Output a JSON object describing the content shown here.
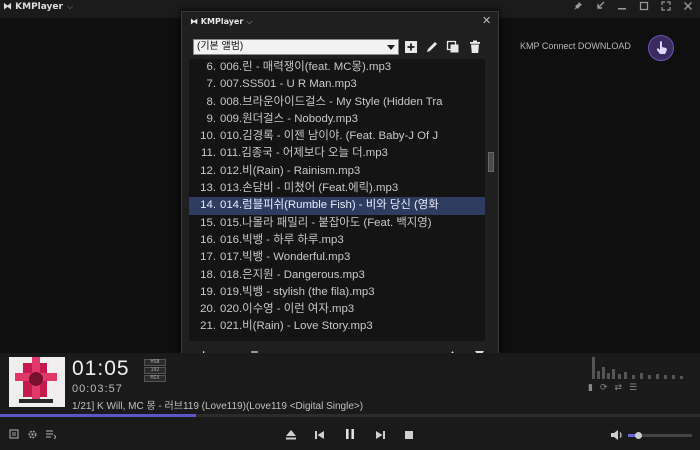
{
  "app": {
    "title": "KMPlayer"
  },
  "connect": {
    "label": "KMP Connect DOWNLOAD"
  },
  "playlist": {
    "title": "KMPlayer",
    "album": "(기본 앨범)",
    "items": [
      {
        "num": "6.",
        "name": "006.린 - 매력쟁이(feat. MC몽).mp3"
      },
      {
        "num": "7.",
        "name": "007.SS501 - U R Man.mp3"
      },
      {
        "num": "8.",
        "name": "008.브라운아이드걸스 - My Style (Hidden Tra"
      },
      {
        "num": "9.",
        "name": "009.원더걸스 - Nobody.mp3"
      },
      {
        "num": "10.",
        "name": "010.김경록 - 이젠 남이야. (Feat. Baby-J Of J"
      },
      {
        "num": "11.",
        "name": "011.김종국 - 어제보다 오늘 더.mp3"
      },
      {
        "num": "12.",
        "name": "012.비(Rain) - Rainism.mp3"
      },
      {
        "num": "13.",
        "name": "013.손담비 - 미쳤어 (Feat.에릭).mp3"
      },
      {
        "num": "14.",
        "name": "014.럼블피쉬(Rumble Fish) - 비와 당신 (영화"
      },
      {
        "num": "15.",
        "name": "015.나몰라 패밀리 - 붙잡아도 (Feat. 백지영)"
      },
      {
        "num": "16.",
        "name": "016.빅뱅 - 하루 하루.mp3"
      },
      {
        "num": "17.",
        "name": "017.빅뱅 - Wonderful.mp3"
      },
      {
        "num": "18.",
        "name": "018.은지원 - Dangerous.mp3"
      },
      {
        "num": "19.",
        "name": "019.빅뱅 - stylish (the fila).mp3"
      },
      {
        "num": "20.",
        "name": "020.이수영 - 이런 여자.mp3"
      },
      {
        "num": "21.",
        "name": "021.비(Rain) - Love Story.mp3"
      }
    ],
    "selected_index": 8
  },
  "player": {
    "elapsed": "01:05",
    "total": "00:03:57",
    "badges": [
      "HSB",
      "192",
      "MIX"
    ],
    "now_playing": "1/21] K Will, MC 몽 - 러브119 (Love119)(Love119 <Digital Single>)",
    "progress": 0.28,
    "volume": 0.16
  },
  "colors": {
    "accent": "#5b57c9",
    "selection": "#2d3c5f"
  }
}
